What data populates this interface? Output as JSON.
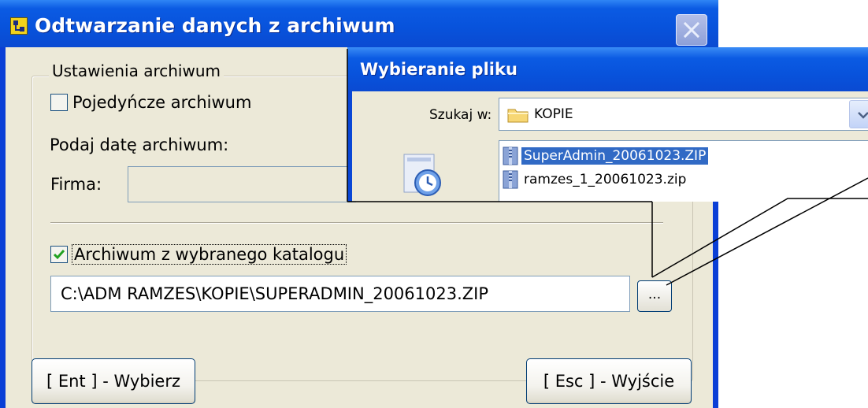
{
  "main_window": {
    "title": "Odtwarzanie danych z archiwum",
    "group_title": "Ustawienia archiwum",
    "single_archive": {
      "label": "Pojedyńcze archiwum",
      "checked": false
    },
    "date_label": "Podaj datę archiwum:",
    "company_label": "Firma:",
    "company_value": "",
    "catalog_archive": {
      "label": "Archiwum z wybranego katalogu",
      "checked": true
    },
    "path_value": "C:\\ADM RAMZES\\KOPIE\\SUPERADMIN_20061023.ZIP",
    "browse_label": "...",
    "select_button": "[ Ent ] - Wybierz",
    "exit_button": "[ Esc ] - Wyjście"
  },
  "file_dialog": {
    "title": "Wybieranie pliku",
    "look_in_label": "Szukaj w:",
    "look_in_value": "KOPIE",
    "files": [
      {
        "name": "SuperAdmin_20061023.ZIP",
        "selected": true
      },
      {
        "name": "ramzes_1_20061023.zip",
        "selected": false
      }
    ]
  },
  "colors": {
    "titlebar": "#0853dc",
    "client": "#ece9d8",
    "selection": "#316ac5",
    "check": "#21a121"
  },
  "icons": [
    "app-icon",
    "close-icon",
    "checkmark-icon",
    "folder-icon",
    "chevron-down-icon",
    "recent-places-icon",
    "zip-file-icon"
  ]
}
